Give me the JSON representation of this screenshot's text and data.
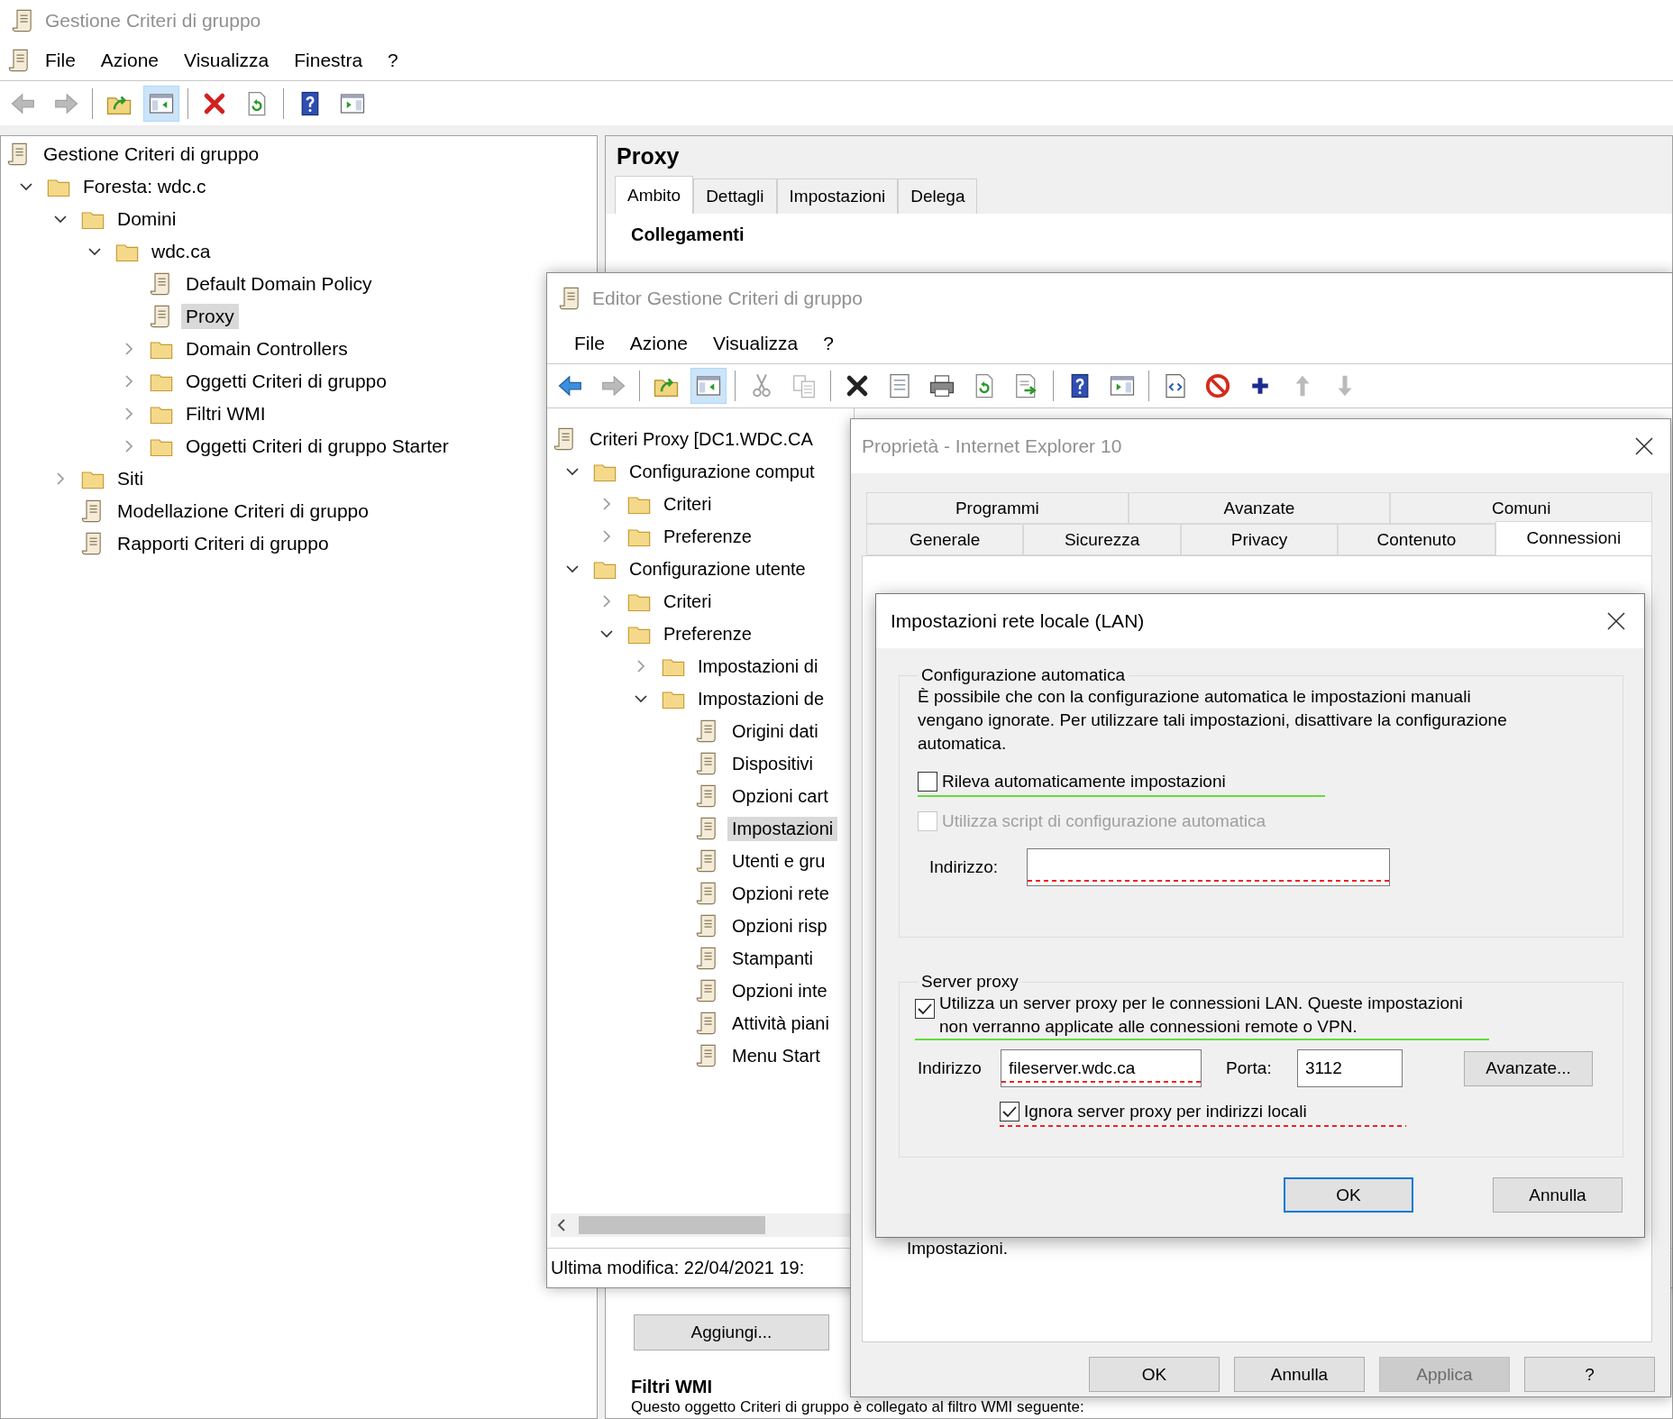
{
  "main_window": {
    "title": "Gestione Criteri di gruppo",
    "menu": [
      "File",
      "Azione",
      "Visualizza",
      "Finestra",
      "?"
    ],
    "toolbar": [
      {
        "pressed": false,
        "disabled": true
      },
      {
        "pressed": false,
        "disabled": true
      },
      {
        "pressed": false,
        "disabled": false
      },
      {
        "pressed": true,
        "disabled": false
      },
      {
        "pressed": false,
        "disabled": false
      },
      {
        "pressed": false,
        "disabled": false
      },
      {
        "pressed": false,
        "disabled": false
      },
      {
        "pressed": false,
        "disabled": false
      }
    ],
    "tree": [
      {
        "label": "Gestione Criteri di gruppo",
        "selected": false,
        "children": [
          {
            "label": "Foresta: wdc.c",
            "expanded": true,
            "selected": false,
            "children": [
              {
                "label": "Domini",
                "expanded": true,
                "selected": false,
                "children": [
                  {
                    "label": "wdc.ca",
                    "expanded": true,
                    "selected": false,
                    "children": [
                      {
                        "label": "Default Domain Policy",
                        "selected": false
                      },
                      {
                        "label": "Proxy",
                        "selected": true
                      },
                      {
                        "label": "Domain Controllers",
                        "expanded": false,
                        "selected": false
                      },
                      {
                        "label": "Oggetti Criteri di gruppo",
                        "expanded": false,
                        "selected": false
                      },
                      {
                        "label": "Filtri WMI",
                        "expanded": false,
                        "selected": false
                      },
                      {
                        "label": "Oggetti Criteri di gruppo Starter",
                        "expanded": false,
                        "selected": false
                      }
                    ]
                  }
                ]
              },
              {
                "label": "Siti",
                "expanded": false,
                "selected": false
              },
              {
                "label": "Modellazione Criteri di gruppo",
                "selected": false
              },
              {
                "label": "Rapporti Criteri di gruppo",
                "selected": false
              }
            ]
          }
        ]
      }
    ],
    "detail": {
      "title": "Proxy",
      "tabs": [
        {
          "label": "Ambito",
          "selected": true
        },
        {
          "label": "Dettagli",
          "selected": false
        },
        {
          "label": "Impostazioni",
          "selected": false
        },
        {
          "label": "Delega",
          "selected": false
        }
      ],
      "section": "Collegamenti",
      "add_button": "Aggiungi...",
      "wmi_heading": "Filtri WMI",
      "wmi_text": "Questo oggetto Criteri di gruppo è collegato al filtro WMI seguente:"
    }
  },
  "editor_window": {
    "title": "Editor Gestione Criteri di gruppo",
    "menu": [
      "File",
      "Azione",
      "Visualizza",
      "?"
    ],
    "toolbar": [
      {
        "pressed": false,
        "disabled": false
      },
      {
        "pressed": false,
        "disabled": true
      },
      {
        "pressed": false,
        "disabled": false
      },
      {
        "pressed": true,
        "disabled": false
      },
      {
        "pressed": false,
        "disabled": true
      },
      {
        "pressed": false,
        "disabled": true
      },
      {
        "pressed": false,
        "disabled": false
      },
      {
        "pressed": false,
        "disabled": false
      },
      {
        "pressed": false,
        "disabled": false
      },
      {
        "pressed": false,
        "disabled": false
      },
      {
        "pressed": false,
        "disabled": false
      },
      {
        "pressed": false,
        "disabled": false
      },
      {
        "pressed": false,
        "disabled": false
      },
      {
        "pressed": false,
        "disabled": false
      },
      {
        "pressed": false,
        "disabled": false
      },
      {
        "pressed": false,
        "disabled": false
      },
      {
        "pressed": false,
        "disabled": true
      },
      {
        "pressed": false,
        "disabled": true
      }
    ],
    "tree": [
      {
        "label": "Criteri Proxy [DC1.WDC.CA",
        "selected": false,
        "children": [
          {
            "label": "Configurazione comput",
            "expanded": true,
            "selected": false,
            "children": [
              {
                "label": "Criteri",
                "expanded": false,
                "selected": false
              },
              {
                "label": "Preferenze",
                "expanded": false,
                "selected": false
              }
            ]
          },
          {
            "label": "Configurazione utente",
            "expanded": true,
            "selected": false,
            "children": [
              {
                "label": "Criteri",
                "expanded": false,
                "selected": false
              },
              {
                "label": "Preferenze",
                "expanded": true,
                "selected": false,
                "children": [
                  {
                    "label": "Impostazioni di",
                    "expanded": false,
                    "selected": false
                  },
                  {
                    "label": "Impostazioni de",
                    "expanded": true,
                    "selected": false,
                    "children": [
                      {
                        "label": "Origini dati",
                        "selected": false
                      },
                      {
                        "label": "Dispositivi",
                        "selected": false
                      },
                      {
                        "label": "Opzioni cart",
                        "selected": false
                      },
                      {
                        "label": "Impostazioni",
                        "selected": true
                      },
                      {
                        "label": "Utenti e gru",
                        "selected": false
                      },
                      {
                        "label": "Opzioni rete",
                        "selected": false
                      },
                      {
                        "label": "Opzioni risp",
                        "selected": false
                      },
                      {
                        "label": "Stampanti",
                        "selected": false
                      },
                      {
                        "label": "Opzioni inte",
                        "selected": false
                      },
                      {
                        "label": "Attività piani",
                        "selected": false
                      },
                      {
                        "label": "Menu Start",
                        "selected": false
                      }
                    ]
                  }
                ]
              }
            ]
          }
        ]
      }
    ],
    "status": "Ultima modifica: 22/04/2021 19:"
  },
  "properties_dialog": {
    "title": "Proprietà - Internet Explorer 10",
    "tab_rows": [
      [
        {
          "label": "Programmi",
          "selected": false
        },
        {
          "label": "Avanzate",
          "selected": false
        },
        {
          "label": "Comuni",
          "selected": false
        }
      ],
      [
        {
          "label": "Generale",
          "selected": false
        },
        {
          "label": "Sicurezza",
          "selected": false
        },
        {
          "label": "Privacy",
          "selected": false
        },
        {
          "label": "Contenuto",
          "selected": false
        },
        {
          "label": "Connessioni",
          "selected": true
        }
      ]
    ],
    "note": "Impostazioni.",
    "buttons": [
      {
        "label": "OK",
        "disabled": false
      },
      {
        "label": "Annulla",
        "disabled": false
      },
      {
        "label": "Applica",
        "disabled": true
      },
      {
        "label": "?",
        "disabled": false
      }
    ]
  },
  "lan_dialog": {
    "title": "Impostazioni rete locale (LAN)",
    "auto_config": {
      "legend": "Configurazione automatica",
      "description": "È possibile che con la configurazione automatica le impostazioni manuali vengano ignorate. Per utilizzare tali impostazioni, disattivare la configurazione automatica.",
      "options": [
        {
          "label": "Rileva automaticamente impostazioni",
          "checked": false,
          "disabled": false,
          "applied": true
        },
        {
          "label": "Utilizza script di configurazione automatica",
          "checked": false,
          "disabled": true
        }
      ],
      "address": {
        "label": "Indirizzo:",
        "applied": false
      }
    },
    "proxy_server": {
      "legend": "Server proxy",
      "use_proxy": {
        "label": "Utilizza un server proxy per le connessioni LAN. Queste impostazioni non verranno applicate alle connessioni remote o VPN.",
        "checked": true,
        "applied": true
      },
      "address": {
        "label": "Indirizzo",
        "value": "fileserver.wdc.ca",
        "applied": false
      },
      "port": {
        "label": "Porta:",
        "value": "3112"
      },
      "advanced_button": "Avanzate...",
      "bypass_local": {
        "label": "Ignora server proxy per indirizzi locali",
        "checked": true,
        "applied": false
      }
    },
    "buttons": [
      {
        "label": "OK",
        "default": true
      },
      {
        "label": "Annulla",
        "default": false
      }
    ]
  }
}
